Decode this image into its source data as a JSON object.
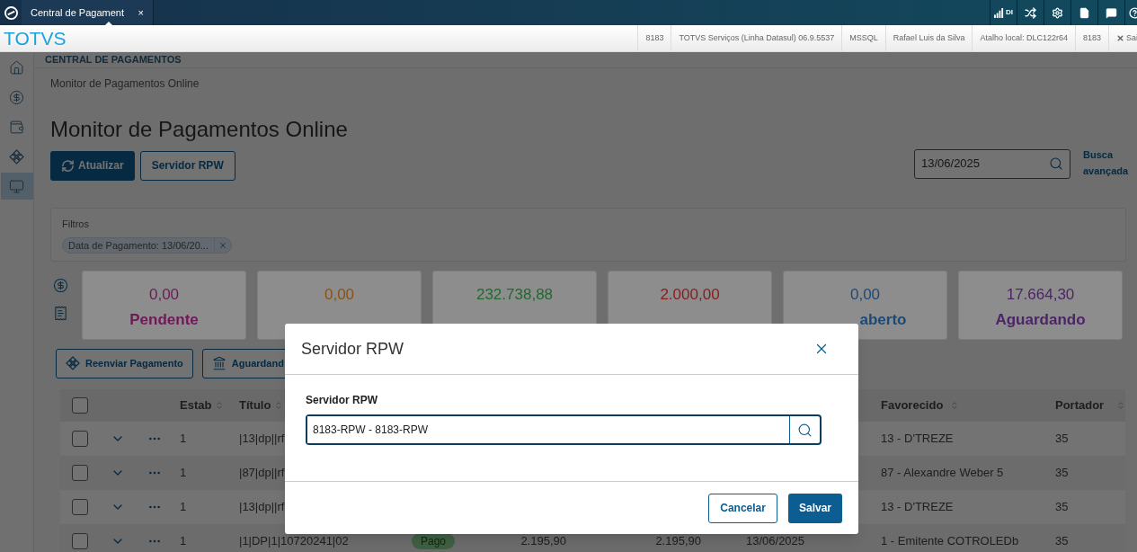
{
  "top_bar": {
    "tabs": [
      {
        "label": "Central de Pagament",
        "selected": true,
        "close": "×"
      }
    ],
    "signal_label": "DI"
  },
  "header": {
    "logo": "TOTVS",
    "info": [
      "8183",
      "TOTVS Serviços (Linha Datasul) 06.9.5537",
      "MSSQL",
      "Rafael Luis da Silva",
      "Atalho local: DLC122r64",
      "8183"
    ],
    "exit": "Sai"
  },
  "sidebar": {
    "items": [
      {
        "kind": "home",
        "selected": false
      },
      {
        "kind": "dollar",
        "selected": false
      },
      {
        "kind": "wallet",
        "selected": false
      },
      {
        "kind": "diamonds",
        "selected": false
      },
      {
        "kind": "monitor",
        "selected": true
      }
    ]
  },
  "breadcrumb": "CENTRAL DE PAGAMENTOS",
  "page": {
    "subtitle": "Monitor de Pagamentos Online",
    "title": "Monitor de Pagamentos Online",
    "buttons": [
      {
        "label": "Atualizar",
        "kind": "primary"
      },
      {
        "label": "Servidor RPW",
        "kind": "secondary"
      }
    ],
    "date_field": {
      "value": "13/06/2025"
    },
    "advanced_search": "Busca avançada"
  },
  "filters": {
    "title": "Filtros",
    "chips": [
      "Data de Pagamento: 13/06/20..."
    ]
  },
  "summary_cards": [
    {
      "value": "0,00",
      "label": "Pendente",
      "color": "#6e1a58"
    },
    {
      "value": "0,00",
      "color": "#8a5218"
    },
    {
      "value": "232.738,88",
      "color": "#1e6b2c"
    },
    {
      "value": "2.000,00",
      "color": "#8a1c1c"
    },
    {
      "value": "0,00",
      "label": "aberto",
      "color": "#1c4a78"
    },
    {
      "value": "17.664,30",
      "label": "Aguardando",
      "color": "#4e2468"
    }
  ],
  "actions": [
    {
      "label": "Reenviar Pagamento",
      "kind": "resend"
    },
    {
      "label": "Aguardand",
      "kind": "bank"
    }
  ],
  "table": {
    "select_all": {
      "checked": false
    },
    "columns": {
      "estab": "Estab",
      "titulo": "Título",
      "favorecido": "Favorecido",
      "portador": "Portador"
    },
    "rows": [
      {
        "checked": false,
        "estab": "1",
        "titulo": "|13|dp||rf",
        "favorecido": "13 - D'TREZE",
        "portador": "35"
      },
      {
        "checked": false,
        "estab": "1",
        "titulo": "|87|dp||rf",
        "favorecido": "87 - Alexandre Weber 5",
        "portador": "35"
      },
      {
        "checked": false,
        "estab": "1",
        "titulo": "|13|dp||rf",
        "favorecido": "13 - D'TREZE",
        "portador": "35"
      },
      {
        "checked": false,
        "estab": "1",
        "titulo": "|1|DP|1|10720241|02",
        "status": "Pago",
        "column_4": "2.195,90",
        "column_5": "2.195,90",
        "date": "13/06/2025",
        "favorecido": "1 - Emitente COTROLEDb",
        "portador": "35"
      }
    ]
  },
  "dialog": {
    "title": "Servidor RPW",
    "field_label": "Servidor RPW",
    "field_value": "8183-RPW - 8183-RPW",
    "buttons": [
      {
        "label": "Cancelar",
        "kind": "secondary"
      },
      {
        "label": "Salvar",
        "kind": "primary"
      }
    ]
  }
}
